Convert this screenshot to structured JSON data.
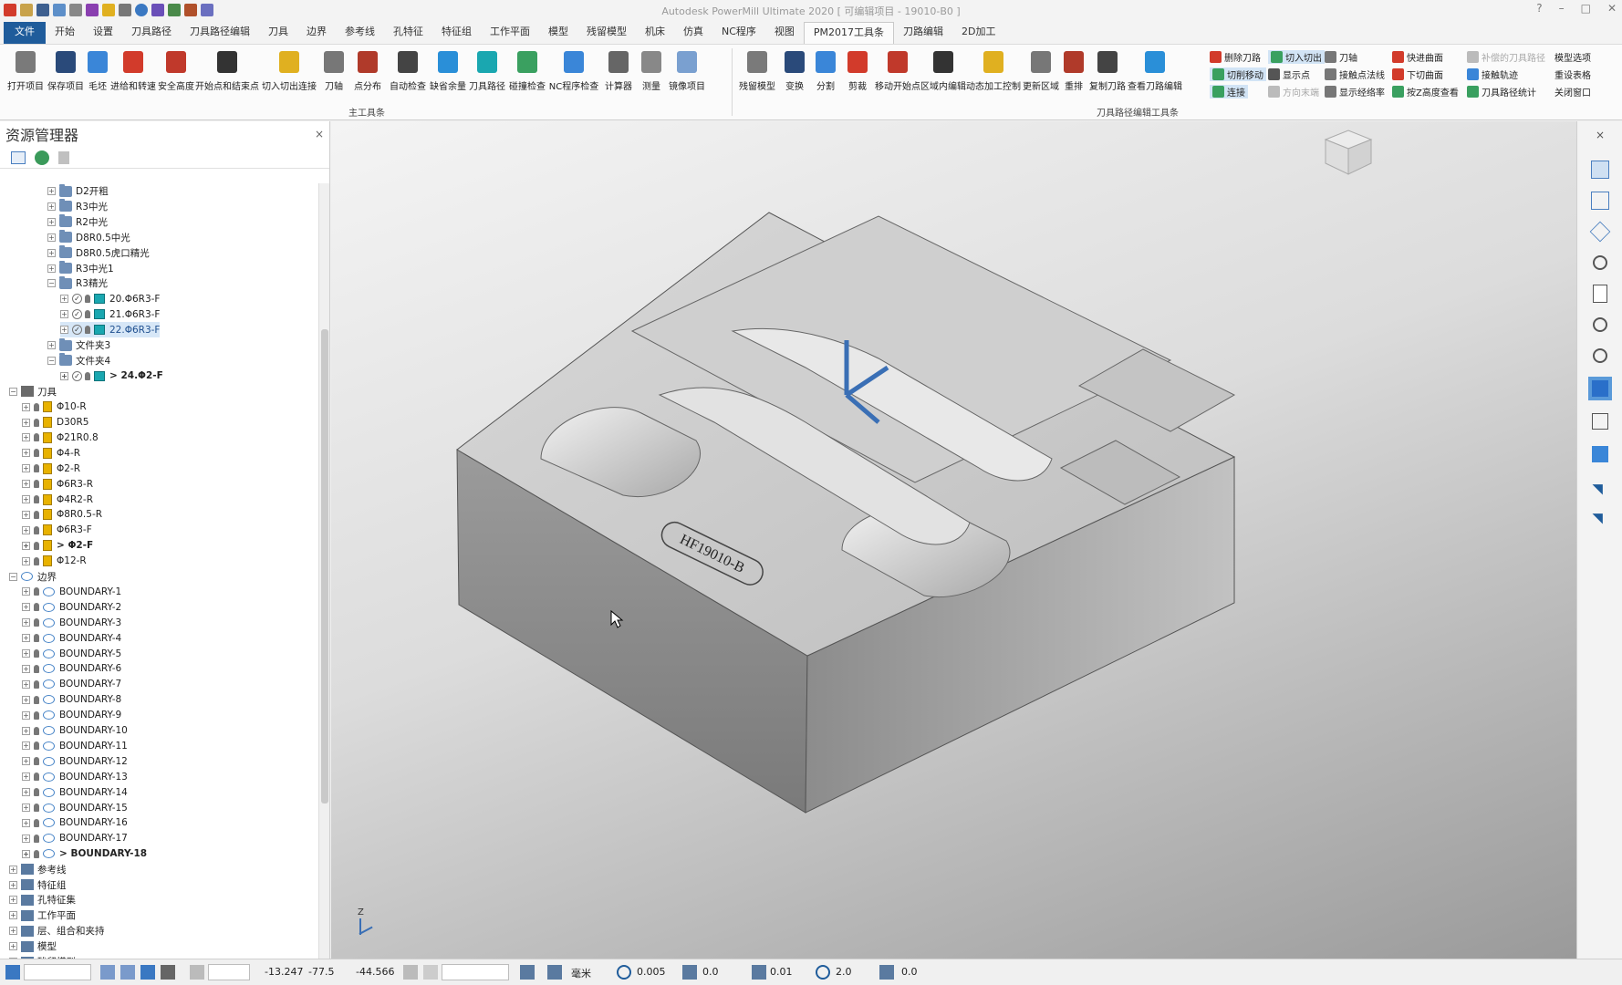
{
  "window": {
    "title": "Autodesk PowerMill Ultimate 2020   [ 可编辑项目 - 19010-B0 ]",
    "help_icon": "?"
  },
  "tabs": [
    "文件",
    "开始",
    "设置",
    "刀具路径",
    "刀具路径编辑",
    "刀具",
    "边界",
    "参考线",
    "孔特征",
    "特征组",
    "工作平面",
    "模型",
    "残留模型",
    "机床",
    "仿真",
    "NC程序",
    "视图",
    "PM2017工具条",
    "刀路编辑",
    "2D加工"
  ],
  "active_tab": "PM2017工具条",
  "ribbon": {
    "main_group_label": "主工具条",
    "edit_group_label": "刀具路径编辑工具条",
    "main_buttons": [
      "打开项目",
      "保存项目",
      "毛坯",
      "进给和转速",
      "安全高度",
      "开始点和结束点",
      "切入切出连接",
      "刀轴",
      "点分布",
      "自动检查",
      "缺省余量",
      "刀具路径",
      "碰撞检查",
      "NC程序检查",
      "计算器",
      "测量",
      "镜像项目"
    ],
    "edit_buttons": [
      "残留模型",
      "变换",
      "分割",
      "剪裁",
      "移动开始点",
      "区域内编辑",
      "动态加工控制",
      "更新区域",
      "重排",
      "复制刀路",
      "查看刀路编辑"
    ],
    "small_col1": [
      "删除刀路",
      "切削移动",
      "连接"
    ],
    "small_col2": [
      "切入切出",
      "显示点",
      "方向末端"
    ],
    "small_col3": [
      "刀轴",
      "接触点法线",
      "显示经络率"
    ],
    "small_col4": [
      "快进曲面",
      "下切曲面",
      "按Z高度查看"
    ],
    "small_col5": [
      "补偿的刀具路径",
      "接触轨迹",
      "刀具路径统计"
    ],
    "small_col6": [
      "模型选项",
      "重设表格",
      "关闭窗口"
    ]
  },
  "explorer": {
    "title": "资源管理器",
    "close": "×",
    "tree": [
      {
        "label": "D2开粗",
        "indent": 3,
        "icon": "folder"
      },
      {
        "label": "R3中光",
        "indent": 3,
        "icon": "folder"
      },
      {
        "label": "R2中光",
        "indent": 3,
        "icon": "folder"
      },
      {
        "label": "D8R0.5中光",
        "indent": 3,
        "icon": "folder"
      },
      {
        "label": "D8R0.5虎口精光",
        "indent": 3,
        "icon": "folder"
      },
      {
        "label": "R3中光1",
        "indent": 3,
        "icon": "folder"
      },
      {
        "label": "R3精光",
        "indent": 3,
        "icon": "folder",
        "open": true
      },
      {
        "label": "20.Φ6R3-F",
        "indent": 4,
        "icon": "toolpath",
        "check": true
      },
      {
        "label": "21.Φ6R3-F",
        "indent": 4,
        "icon": "toolpath",
        "check": true
      },
      {
        "label": "22.Φ6R3-F",
        "indent": 4,
        "icon": "toolpath",
        "check": true,
        "selected": true
      },
      {
        "label": "文件夹3",
        "indent": 3,
        "icon": "folder"
      },
      {
        "label": "文件夹4",
        "indent": 3,
        "icon": "folder",
        "open": true
      },
      {
        "label": "> 24.Φ2-F",
        "indent": 4,
        "icon": "toolpath2",
        "check": true,
        "bold": true
      },
      {
        "label": "刀具",
        "indent": 0,
        "icon": "toolroot",
        "open": true
      },
      {
        "label": "Φ10-R",
        "indent": 1,
        "icon": "tool"
      },
      {
        "label": "D30R5",
        "indent": 1,
        "icon": "tool"
      },
      {
        "label": "Φ21R0.8",
        "indent": 1,
        "icon": "tool"
      },
      {
        "label": "Φ4-R",
        "indent": 1,
        "icon": "tool"
      },
      {
        "label": "Φ2-R",
        "indent": 1,
        "icon": "tool"
      },
      {
        "label": "Φ6R3-R",
        "indent": 1,
        "icon": "tool"
      },
      {
        "label": "Φ4R2-R",
        "indent": 1,
        "icon": "tool"
      },
      {
        "label": "Φ8R0.5-R",
        "indent": 1,
        "icon": "tool"
      },
      {
        "label": "Φ6R3-F",
        "indent": 1,
        "icon": "tool"
      },
      {
        "label": "> Φ2-F",
        "indent": 1,
        "icon": "tool",
        "bold": true
      },
      {
        "label": "Φ12-R",
        "indent": 1,
        "icon": "tool"
      },
      {
        "label": "边界",
        "indent": 0,
        "icon": "bndroot",
        "open": true
      },
      {
        "label": "BOUNDARY-1",
        "indent": 1,
        "icon": "boundary"
      },
      {
        "label": "BOUNDARY-2",
        "indent": 1,
        "icon": "boundary"
      },
      {
        "label": "BOUNDARY-3",
        "indent": 1,
        "icon": "boundary"
      },
      {
        "label": "BOUNDARY-4",
        "indent": 1,
        "icon": "boundary"
      },
      {
        "label": "BOUNDARY-5",
        "indent": 1,
        "icon": "boundary"
      },
      {
        "label": "BOUNDARY-6",
        "indent": 1,
        "icon": "boundary"
      },
      {
        "label": "BOUNDARY-7",
        "indent": 1,
        "icon": "boundary"
      },
      {
        "label": "BOUNDARY-8",
        "indent": 1,
        "icon": "boundary"
      },
      {
        "label": "BOUNDARY-9",
        "indent": 1,
        "icon": "boundary"
      },
      {
        "label": "BOUNDARY-10",
        "indent": 1,
        "icon": "boundary"
      },
      {
        "label": "BOUNDARY-11",
        "indent": 1,
        "icon": "boundary"
      },
      {
        "label": "BOUNDARY-12",
        "indent": 1,
        "icon": "boundary"
      },
      {
        "label": "BOUNDARY-13",
        "indent": 1,
        "icon": "boundary"
      },
      {
        "label": "BOUNDARY-14",
        "indent": 1,
        "icon": "boundary"
      },
      {
        "label": "BOUNDARY-15",
        "indent": 1,
        "icon": "boundary"
      },
      {
        "label": "BOUNDARY-16",
        "indent": 1,
        "icon": "boundary"
      },
      {
        "label": "BOUNDARY-17",
        "indent": 1,
        "icon": "boundary"
      },
      {
        "label": "> BOUNDARY-18",
        "indent": 1,
        "icon": "boundary",
        "bold": true
      },
      {
        "label": "参考线",
        "indent": 0,
        "icon": "misc"
      },
      {
        "label": "特征组",
        "indent": 0,
        "icon": "misc"
      },
      {
        "label": "孔特征集",
        "indent": 0,
        "icon": "misc"
      },
      {
        "label": "工作平面",
        "indent": 0,
        "icon": "misc"
      },
      {
        "label": "层、组合和夹持",
        "indent": 0,
        "icon": "misc"
      },
      {
        "label": "模型",
        "indent": 0,
        "icon": "misc"
      },
      {
        "label": "残留模型",
        "indent": 0,
        "icon": "misc"
      }
    ]
  },
  "viewport": {
    "part_label": "HF19010-B",
    "axis_z": "Z"
  },
  "status": {
    "x": "-13.247",
    "y": "-77.5",
    "z": "-44.566",
    "units": "毫米",
    "tolerance": "0.005",
    "thickness": "0.0",
    "step": "0.01",
    "diameter": "2.0",
    "angle": "0.0"
  },
  "colors": {
    "file_tab": "#1f5c9b",
    "accent": "#2a6fc9",
    "tool": "#e8b200",
    "toolpath": "#1aa7b0"
  }
}
